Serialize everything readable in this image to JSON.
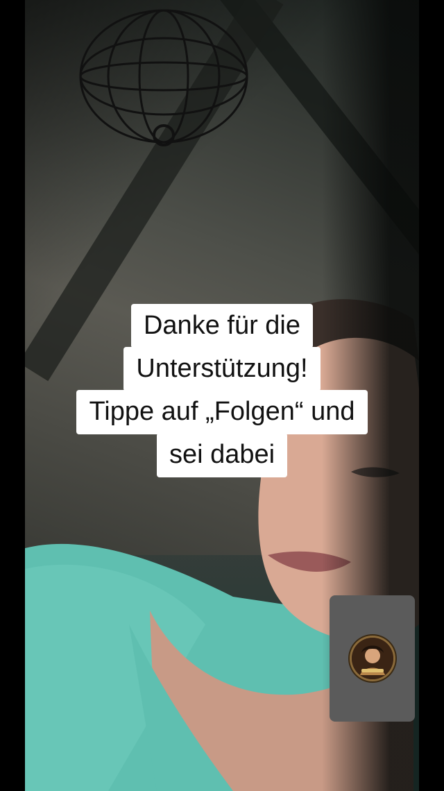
{
  "caption": {
    "lines": [
      "Danke für die",
      "Unterstützung!",
      "Tippe auf „Folgen“ und",
      "sei dabei"
    ]
  },
  "pip": {
    "avatar_icon": "guest-avatar-icon"
  },
  "colors": {
    "caption_bg": "#ffffff",
    "caption_text": "#111111",
    "pip_bg": "#5b5b5b",
    "shirt": "#5fbfb0"
  }
}
